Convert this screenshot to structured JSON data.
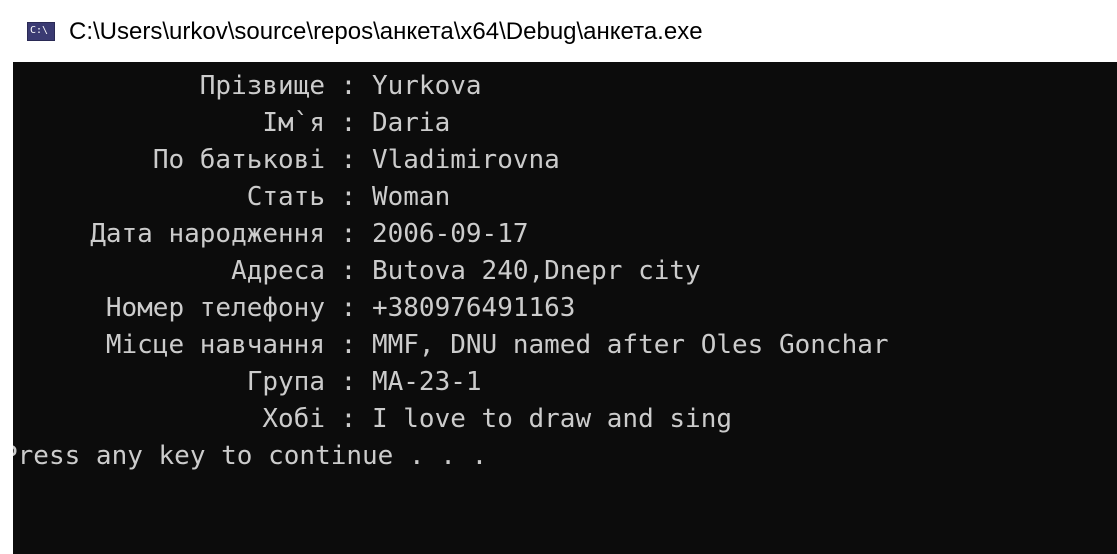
{
  "window": {
    "title": "C:\\Users\\urkov\\source\\repos\\анкета\\x64\\Debug\\анкета.exe",
    "icon": "console-app-icon",
    "icon_text": "C:\\"
  },
  "console": {
    "background": "#0c0c0c",
    "foreground": "#cccccc",
    "separator": " : ",
    "fields": [
      {
        "label": "Прізвище",
        "value": "Yurkova"
      },
      {
        "label": "Ім`я",
        "value": "Daria"
      },
      {
        "label": "По батькові",
        "value": "Vladimirovna"
      },
      {
        "label": "Стать",
        "value": "Woman"
      },
      {
        "label": "Дата народження",
        "value": "2006-09-17"
      },
      {
        "label": "Адреса",
        "value": "Butova 240,Dnepr city"
      },
      {
        "label": "Номер телефону",
        "value": "+380976491163"
      },
      {
        "label": "Місце навчання",
        "value": "MMF, DNU named after Oles Gonchar"
      },
      {
        "label": "Група",
        "value": "МА-23-1"
      },
      {
        "label": "Хобі",
        "value": "I love to draw and sing"
      }
    ],
    "prompt": "Press any key to continue . . ."
  }
}
